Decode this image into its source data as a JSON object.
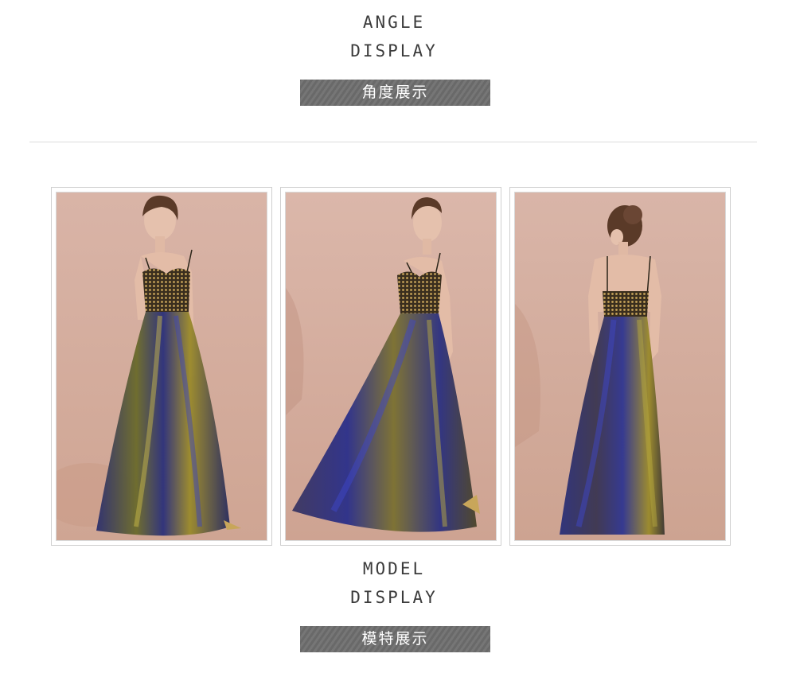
{
  "angle_section": {
    "title_line1": "ANGLE",
    "title_line2": "DISPLAY",
    "label": "角度展示"
  },
  "model_section": {
    "title_line1": "MODEL",
    "title_line2": "DISPLAY",
    "label": "模特展示"
  },
  "photos": [
    {
      "view": "front"
    },
    {
      "view": "side"
    },
    {
      "view": "back"
    }
  ],
  "colors": {
    "background": "#ffffff",
    "label_bar": "#6d6d6d",
    "photo_backdrop": "#d9b5a8",
    "bodice_gold": "#8a6a2c",
    "skirt_blue": "#2a2f7a",
    "skirt_gold": "#9a8a2a"
  }
}
